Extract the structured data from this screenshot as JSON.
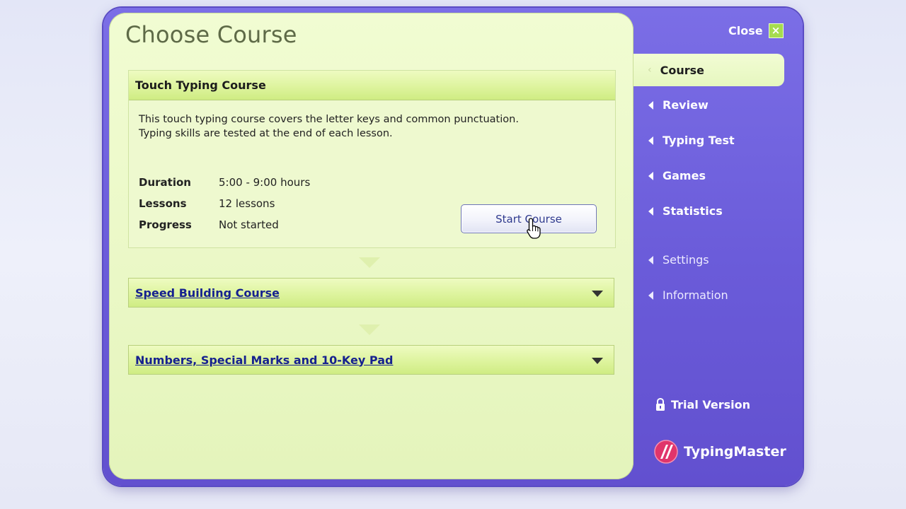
{
  "page": {
    "title": "Choose Course"
  },
  "courses": [
    {
      "title": "Touch Typing Course",
      "description_line1": "This touch typing course covers the letter keys and common punctuation.",
      "description_line2": "Typing skills are tested at the end of each lesson.",
      "duration_label": "Duration",
      "duration_value": "5:00 - 9:00 hours",
      "lessons_label": "Lessons",
      "lessons_value": "12 lessons",
      "progress_label": "Progress",
      "progress_value": "Not started",
      "start_button": "Start Course",
      "expanded": true
    },
    {
      "title": "Speed Building Course",
      "expanded": false
    },
    {
      "title": "Numbers, Special Marks and 10-Key Pad",
      "expanded": false
    }
  ],
  "sidebar": {
    "close_label": "Close",
    "active": "Course",
    "items": [
      "Review",
      "Typing Test",
      "Games",
      "Statistics",
      "Settings",
      "Information"
    ],
    "trial_label": "Trial Version",
    "brand": "TypingMaster"
  },
  "colors": {
    "panel_bg": "#ecf9c9",
    "header_green": "#dcf39b",
    "sidebar_purple": "#6a5bd9",
    "link_blue": "#16218f"
  }
}
